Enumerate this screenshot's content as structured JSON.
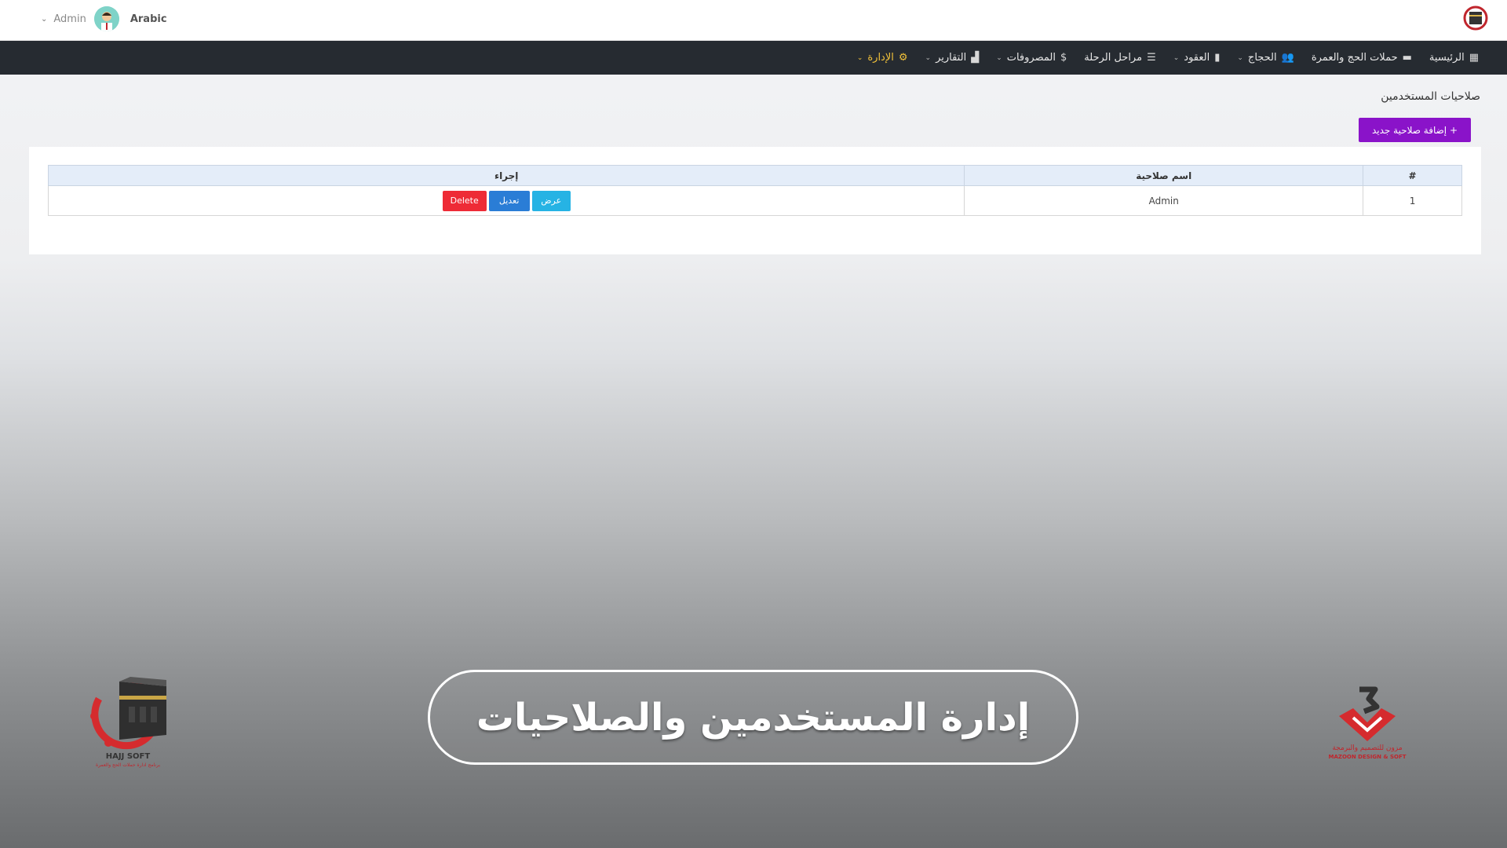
{
  "topbar": {
    "user_name": "Admin",
    "language": "Arabic"
  },
  "nav": {
    "items": [
      {
        "label": "الرئيسية",
        "icon": "dashboard-icon",
        "caret": false
      },
      {
        "label": "حملات الحج والعمرة",
        "icon": "kaaba-icon",
        "caret": false
      },
      {
        "label": "الحجاج",
        "icon": "users-icon",
        "caret": true
      },
      {
        "label": "العقود",
        "icon": "file-icon",
        "caret": true
      },
      {
        "label": "مراحل الرحلة",
        "icon": "list-icon",
        "caret": false
      },
      {
        "label": "المصروفات",
        "icon": "dollar-icon",
        "caret": true
      },
      {
        "label": "التقارير",
        "icon": "chart-icon",
        "caret": true
      },
      {
        "label": "الإدارة",
        "icon": "gear-icon",
        "caret": true,
        "active": true
      }
    ],
    "active_color": "#f2c23a"
  },
  "page": {
    "title": "صلاحيات المستخدمين",
    "add_button": "+ إضافة صلاحية جديد"
  },
  "table": {
    "headers": {
      "number": "#",
      "name": "اسم صلاحية",
      "actions": "إجراء"
    },
    "rows": [
      {
        "number": "1",
        "name": "Admin",
        "view": "عرض",
        "edit": "تعديل",
        "delete": "Delete"
      }
    ]
  },
  "banner": {
    "text": "إدارة المستخدمين والصلاحيات"
  },
  "logos": {
    "left_caption": "HAJJ SOFT",
    "left_subcaption": "برنامج ادارة حملات الحج والعمرة",
    "right_caption": "مزون للتصميم والبرمجة",
    "right_subcaption": "MAZOON DESIGN & SOFT"
  },
  "colors": {
    "navbar": "#262b31",
    "add_button": "#8a13c9",
    "view_button": "#26b3e4",
    "edit_button": "#2a7dd6",
    "delete_button": "#ee2b36"
  }
}
